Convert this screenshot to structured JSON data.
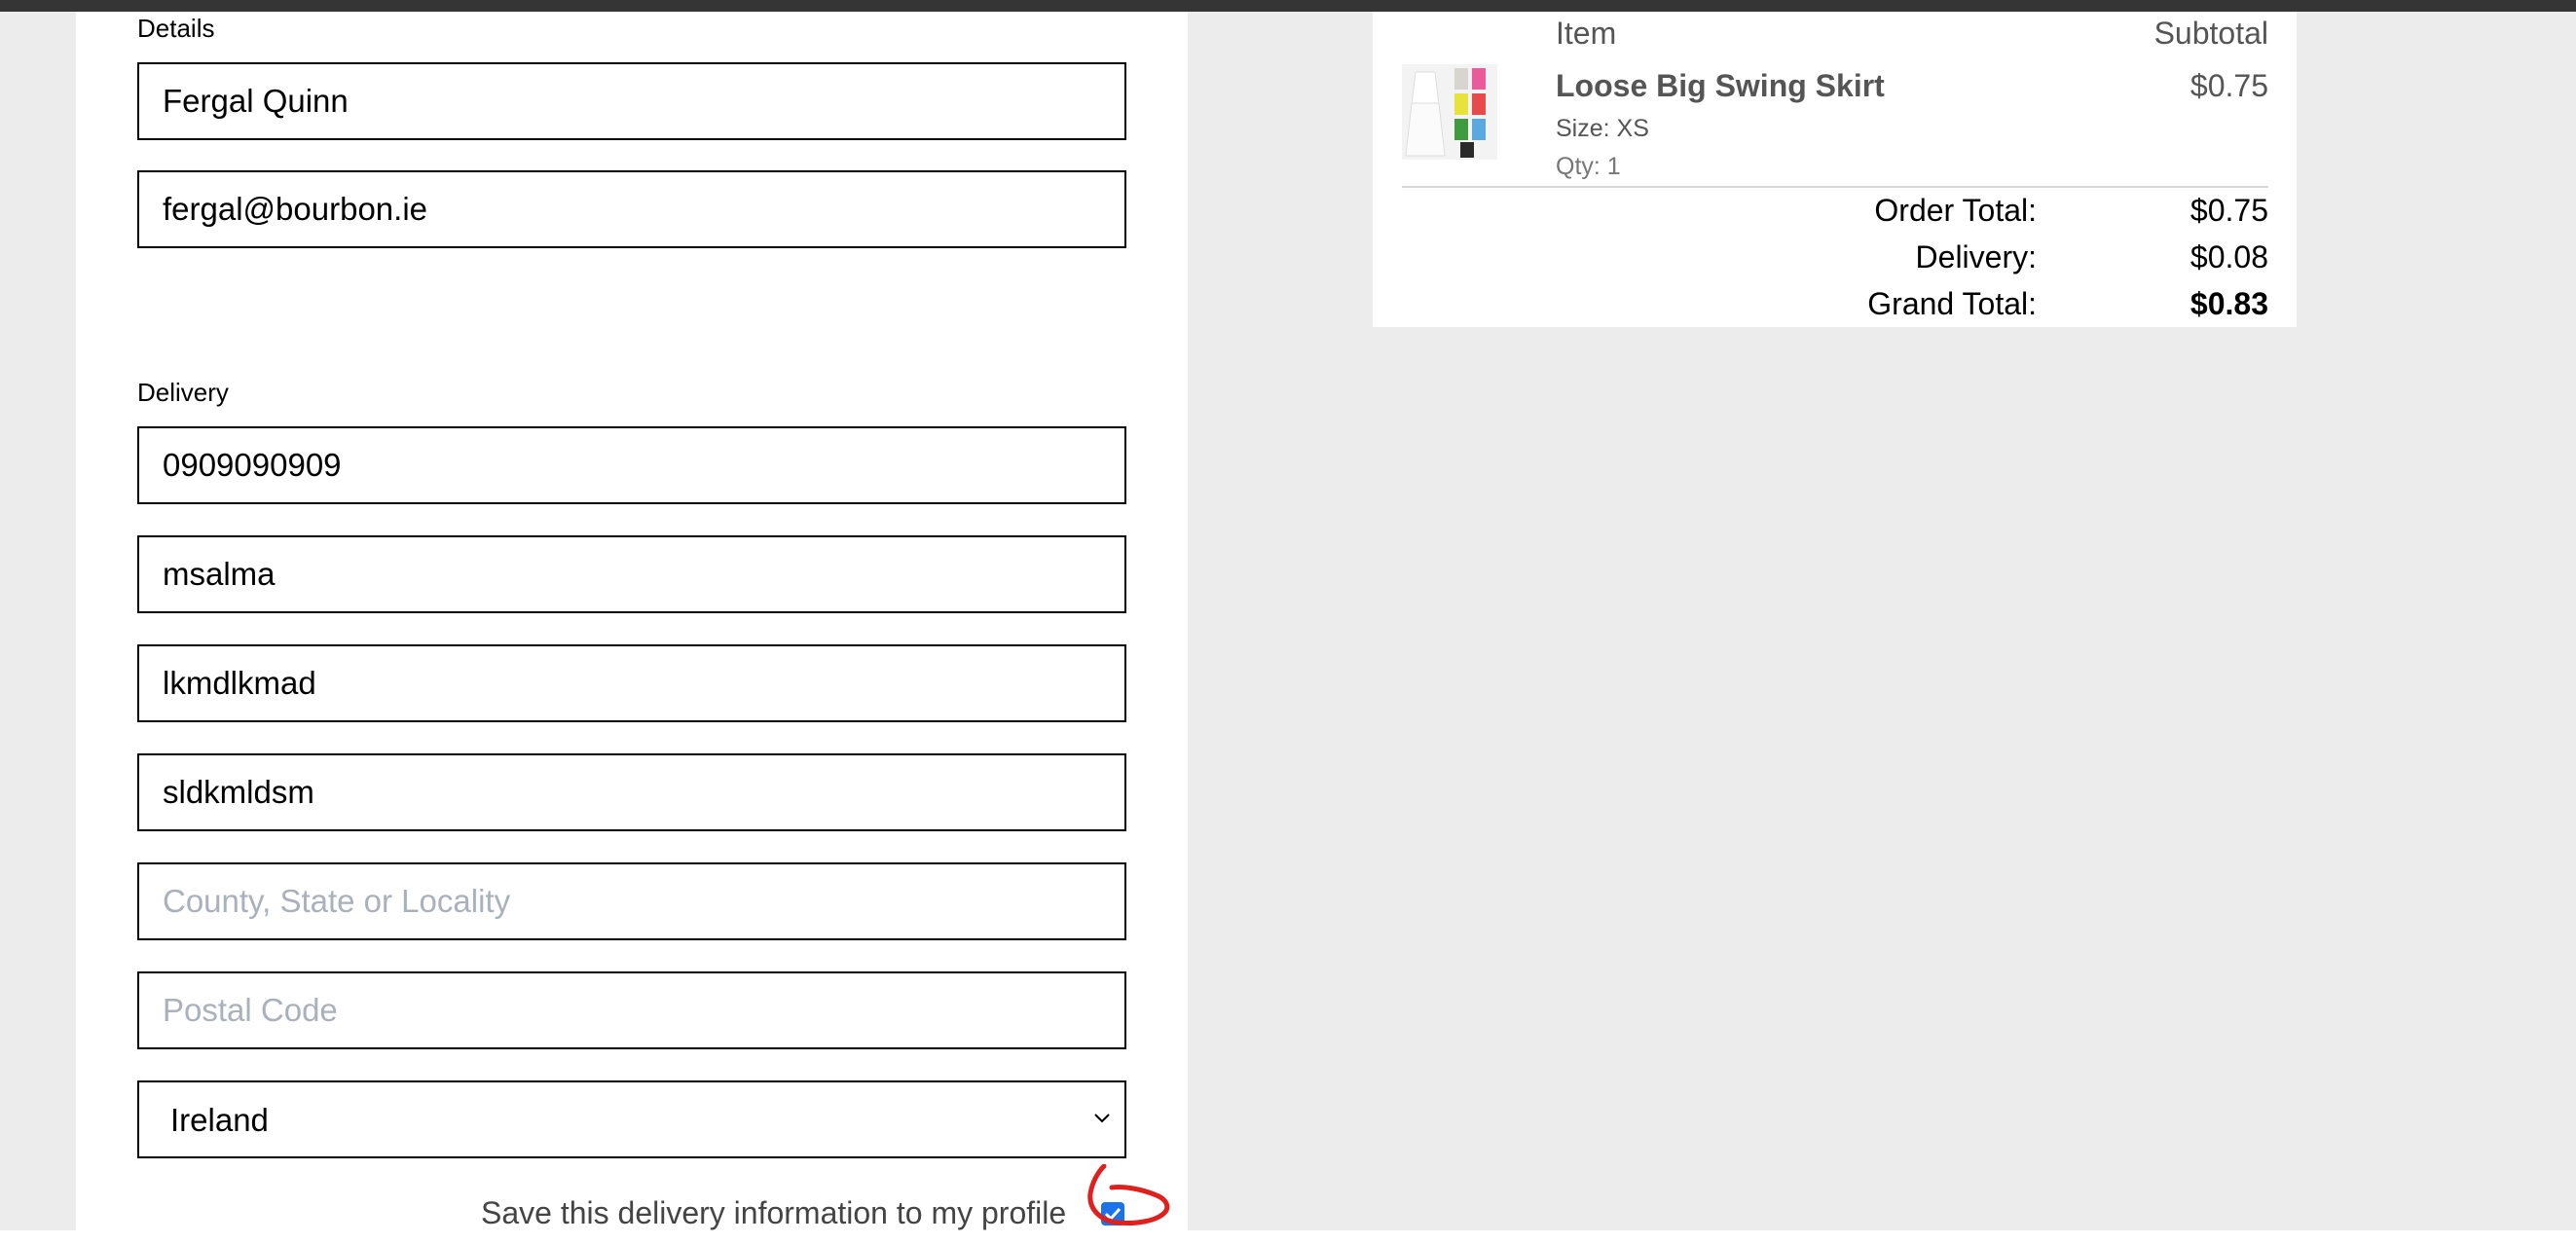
{
  "details": {
    "label": "Details",
    "full_name": "Fergal Quinn",
    "email": "fergal@bourbon.ie"
  },
  "delivery": {
    "label": "Delivery",
    "phone": "0909090909",
    "address_line1": "msalma",
    "address_line2": "lkmdlkmad",
    "city": "sldkmldsm",
    "county_placeholder": "County, State or Locality",
    "postal_placeholder": "Postal Code",
    "country": "Ireland",
    "save_label": "Save this delivery information to my profile",
    "save_checked": true
  },
  "summary": {
    "col_item": "Item",
    "col_subtotal": "Subtotal",
    "item": {
      "name": "Loose Big Swing Skirt",
      "size": "Size: XS",
      "qty": "Qty: 1",
      "price": "$0.75"
    },
    "order_total_label": "Order Total:",
    "order_total": "$0.75",
    "delivery_label": "Delivery:",
    "delivery_cost": "$0.08",
    "grand_total_label": "Grand Total:",
    "grand_total": "$0.83"
  },
  "colors": {
    "checkbox": "#1a73e8",
    "annotation": "#e0201c",
    "placeholder": "#a9b1bd"
  }
}
